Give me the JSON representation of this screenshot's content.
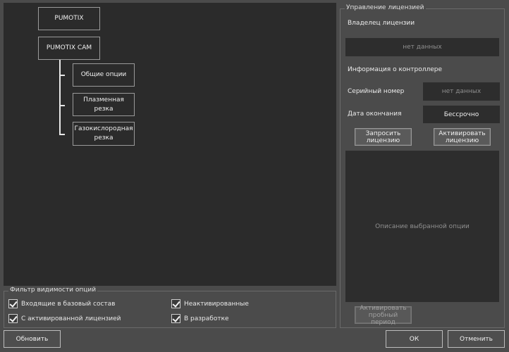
{
  "tree": {
    "nodes": [
      {
        "label": "PUMOTIX",
        "expanded": false
      },
      {
        "label": "PUMOTIX CAM",
        "expanded": true,
        "children": [
          {
            "label": "Общие опции"
          },
          {
            "label": "Плазменная резка"
          },
          {
            "label": "Газокислородная\nрезка"
          }
        ]
      }
    ]
  },
  "filter": {
    "title": "Фильтр видимости опций",
    "options": [
      {
        "label": "Входящие в базовый состав",
        "checked": true
      },
      {
        "label": "Неактивированные",
        "checked": true
      },
      {
        "label": "С активированной лицензией",
        "checked": true
      },
      {
        "label": "В разработке",
        "checked": true
      }
    ]
  },
  "license": {
    "title": "Управление лицензией",
    "owner_label": "Владелец лицензии",
    "owner_value": "нет данных",
    "controller_info_label": "Информация о контроллере",
    "serial_label": "Серийный номер",
    "serial_value": "нет данных",
    "expiry_label": "Дата окончания",
    "expiry_value": "Бессрочно",
    "request_button": "Запросить\nлицензию",
    "activate_button": "Активировать\nлицензию",
    "description_placeholder": "Описание выбранной опции",
    "trial_button": "Активировать\nпробный период"
  },
  "footer": {
    "refresh_button": "Обновить",
    "ok_button": "ОК",
    "cancel_button": "Отменить"
  },
  "colors": {
    "background": "#4b4b4b",
    "panel": "#2b2b2b",
    "field": "#2d2d2d",
    "text": "#ececec",
    "muted": "#8f8f8f"
  }
}
